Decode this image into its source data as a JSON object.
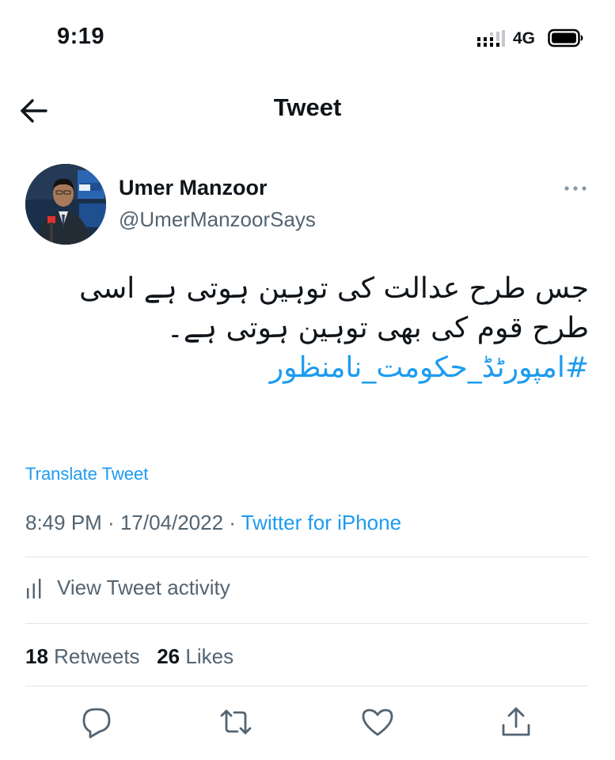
{
  "status_bar": {
    "time": "9:19",
    "network": "4G"
  },
  "header": {
    "title": "Tweet",
    "back_icon": "arrow-left-icon"
  },
  "author": {
    "name": "Umer Manzoor",
    "handle": "@UmerManzoorSays",
    "avatar_icon": "avatar"
  },
  "tweet": {
    "text": "جس طرح عدالت کی توہین ہوتی ہے اسی طرح قوم کی بھی توہین ہوتی ہے۔",
    "hashtag": "#امپورٹڈ_حکومت_نامنظور",
    "translate_label": "Translate Tweet"
  },
  "meta": {
    "time": "8:49 PM",
    "separator": " · ",
    "date": "17/04/2022",
    "source": "Twitter for iPhone"
  },
  "activity": {
    "label": "View Tweet activity"
  },
  "stats": {
    "retweets": "18",
    "retweets_label": "Retweets",
    "likes": "26",
    "likes_label": "Likes"
  },
  "actions": [
    "reply-icon",
    "retweet-icon",
    "like-icon",
    "share-icon"
  ],
  "colors": {
    "accent": "#1d9bf0",
    "secondary_text": "#536471",
    "divider": "#e1e6ea"
  }
}
